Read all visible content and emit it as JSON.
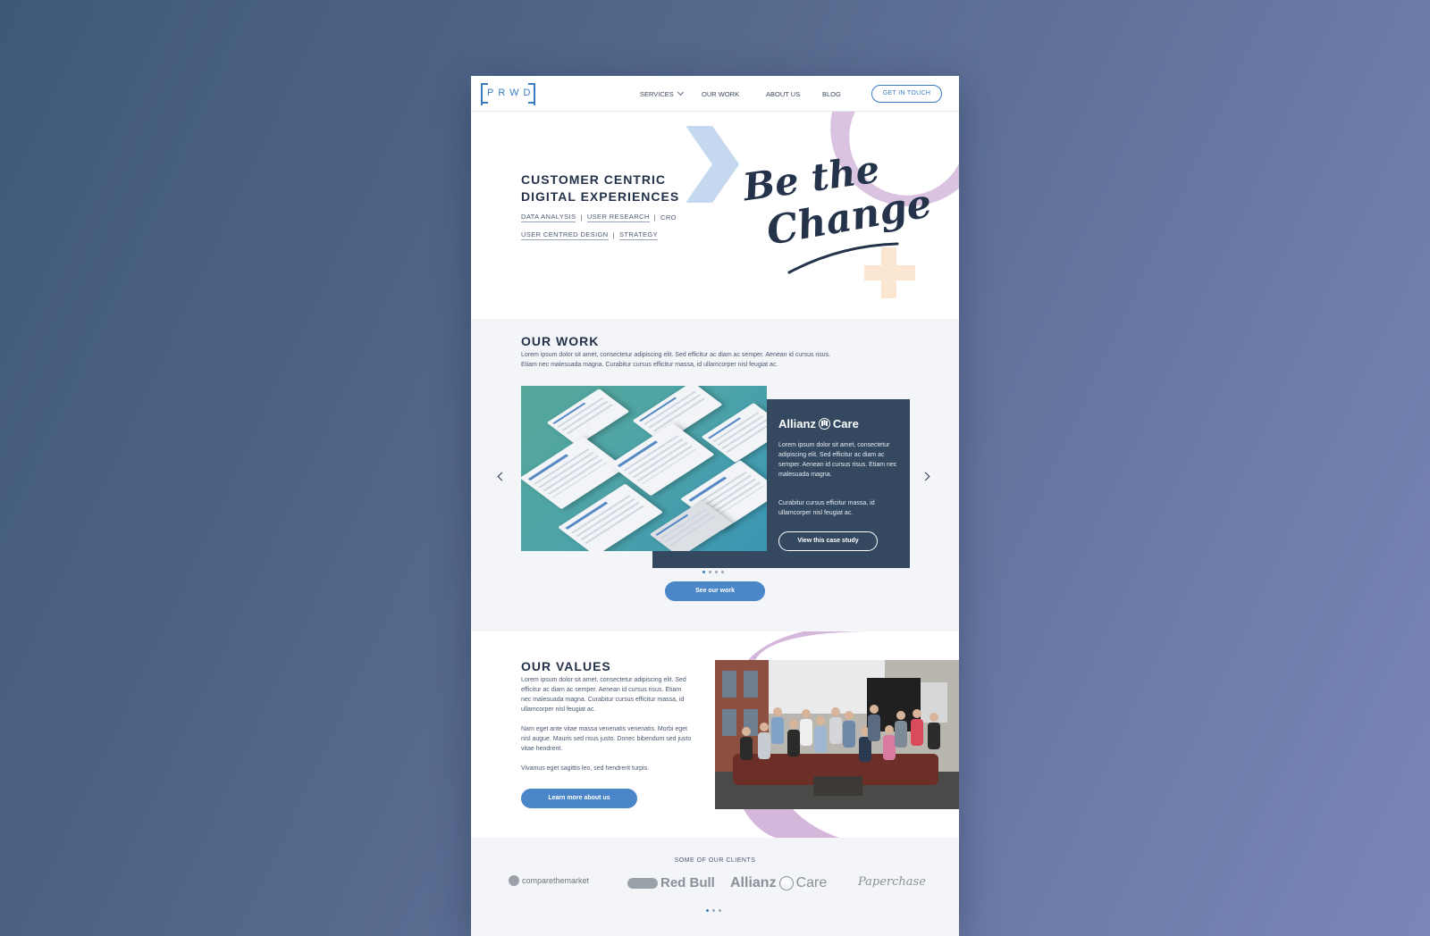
{
  "header": {
    "logo_text": "PRWD",
    "nav": {
      "services": "SERVICES",
      "our_work": "OUR WORK",
      "about_us": "ABOUT US",
      "blog": "BLOG"
    },
    "cta_label": "GET IN TOUCH"
  },
  "hero": {
    "title_line1": "CUSTOMER CENTRIC",
    "title_line2": "DIGITAL EXPERIENCES",
    "tags_row1": [
      "DATA ANALYSIS",
      "USER RESEARCH",
      "CRO"
    ],
    "tags_row2": [
      "USER CENTRED DESIGN",
      "STRATEGY"
    ],
    "script_line1": "Be the",
    "script_line2": "Change",
    "colors": {
      "accent_blue": "#c5d8ef",
      "accent_purple": "#d9c3e0",
      "accent_peach": "#fbe6d2",
      "navy": "#24324a"
    }
  },
  "our_work": {
    "title": "OUR WORK",
    "intro_line1": "Lorem ipsum dolor sit amet, consectetur adipiscing elit. Sed efficitur ac diam ac semper. Aenean id cursus risus.",
    "intro_line2": "Etiam nec malesuada magna. Curabitur cursus efficitur massa, id ullamcorper nisl feugiat ac.",
    "card": {
      "client_left": "Allianz",
      "client_right": "Care",
      "para1": "Lorem ipsum dolor sit amet, consectetur adipiscing elit. Sed efficitur ac diam ac semper. Aenean id cursus risus. Etiam nec malesuada magna.",
      "para2": "Curabitur cursus efficitur massa, id ullamcorper nisl feugiat ac.",
      "button_label": "View this case study"
    },
    "slides_count": 4,
    "active_slide": 1,
    "button_label": "See our work"
  },
  "our_values": {
    "title": "OUR VALUES",
    "para1": "Lorem ipsum dolor sit amet, consectetur adipiscing elit. Sed efficitur ac diam ac semper. Aenean id cursus risus. Etiam nec malesuada magna. Curabitur cursus efficitur massa, id ullamcorper nisl feugiat ac.",
    "para2": "Nam eget ante vitae massa venenatis venenatis. Morbi eget nisl augue. Mauris sed risus justo. Donec bibendum sed justo vitae hendrerit.",
    "para3": "Vivamus eget sagittis leo, sed hendrerit turpis.",
    "button_label": "Learn more about us"
  },
  "clients": {
    "label": "SOME OF OUR CLIENTS",
    "logos": {
      "comparethemarket": "comparethemarket",
      "redbull": "Red Bull",
      "allianz_left": "Allianz",
      "allianz_right": "Care",
      "paperchase": "Paperchase"
    },
    "slides_count": 3,
    "active_slide": 1
  }
}
